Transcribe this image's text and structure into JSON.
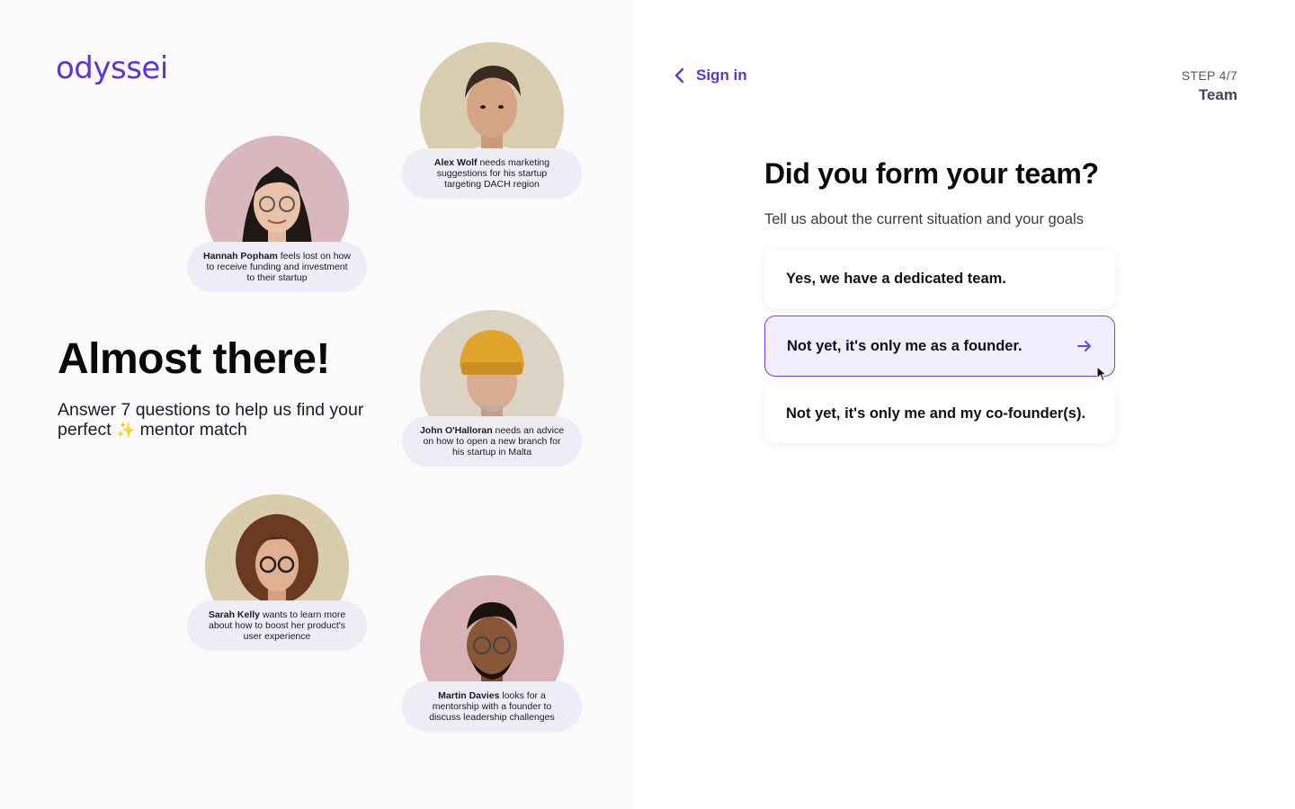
{
  "brand": {
    "logo": "odyssei",
    "accent": "#5b35d8"
  },
  "intro": {
    "headline": "Almost there!",
    "sub_before": "Answer 7 questions to help us find your perfect ",
    "sub_after": " mentor match",
    "sparkle_icon": "sparkles-icon"
  },
  "personas": [
    {
      "name": "Alex Wolf",
      "text": " needs marketing suggestions for his startup targeting DACH region",
      "photo_bg": "#d9cdb0"
    },
    {
      "name": "Hannah Popham",
      "text": " feels lost on how to receive funding and investment to their startup",
      "photo_bg": "#d9b7be"
    },
    {
      "name": "John O'Halloran",
      "text": " needs an advice on how to open a new branch for his startup in Malta",
      "photo_bg": "#ddd3c4"
    },
    {
      "name": "Sarah Kelly",
      "text": " wants to learn more about how to boost her product's user experience",
      "photo_bg": "#d8ccaa"
    },
    {
      "name": "Martin Davies",
      "text": " looks for a mentorship with a founder to discuss leadership challenges",
      "photo_bg": "#d7b3b7"
    }
  ],
  "nav": {
    "back_label": "Sign in"
  },
  "step": {
    "number": "STEP 4/7",
    "name": "Team"
  },
  "question": {
    "title": "Did you form your team?",
    "description": "Tell us about the current situation and your goals",
    "options": [
      {
        "label": "Yes, we have a dedicated team."
      },
      {
        "label": "Not yet, it's only me as a founder.",
        "selected": true
      },
      {
        "label": "Not yet, it's only me and my co-founder(s)."
      }
    ]
  }
}
